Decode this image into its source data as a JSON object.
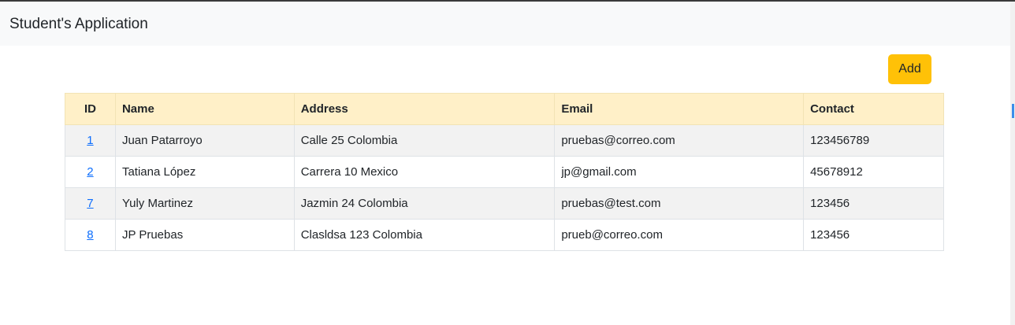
{
  "header": {
    "brand": "Student's Application"
  },
  "toolbar": {
    "add_label": "Add"
  },
  "table": {
    "columns": [
      "ID",
      "Name",
      "Address",
      "Email",
      "Contact"
    ],
    "rows": [
      {
        "id": "1",
        "name": "Juan Patarroyo",
        "address": "Calle 25 Colombia",
        "email": "pruebas@correo.com",
        "contact": "123456789"
      },
      {
        "id": "2",
        "name": "Tatiana López",
        "address": "Carrera 10 Mexico",
        "email": "jp@gmail.com",
        "contact": "45678912"
      },
      {
        "id": "7",
        "name": "Yuly Martinez",
        "address": "Jazmin 24 Colombia",
        "email": "pruebas@test.com",
        "contact": "123456"
      },
      {
        "id": "8",
        "name": "JP Pruebas",
        "address": "Clasldsa 123 Colombia",
        "email": "prueb@correo.com",
        "contact": "123456"
      }
    ]
  },
  "colors": {
    "header_bg": "#fff0c8",
    "add_button": "#ffc107",
    "link": "#0d6efd",
    "stripe": "#f2f2f2",
    "navbar_bg": "#f8f9fa"
  }
}
